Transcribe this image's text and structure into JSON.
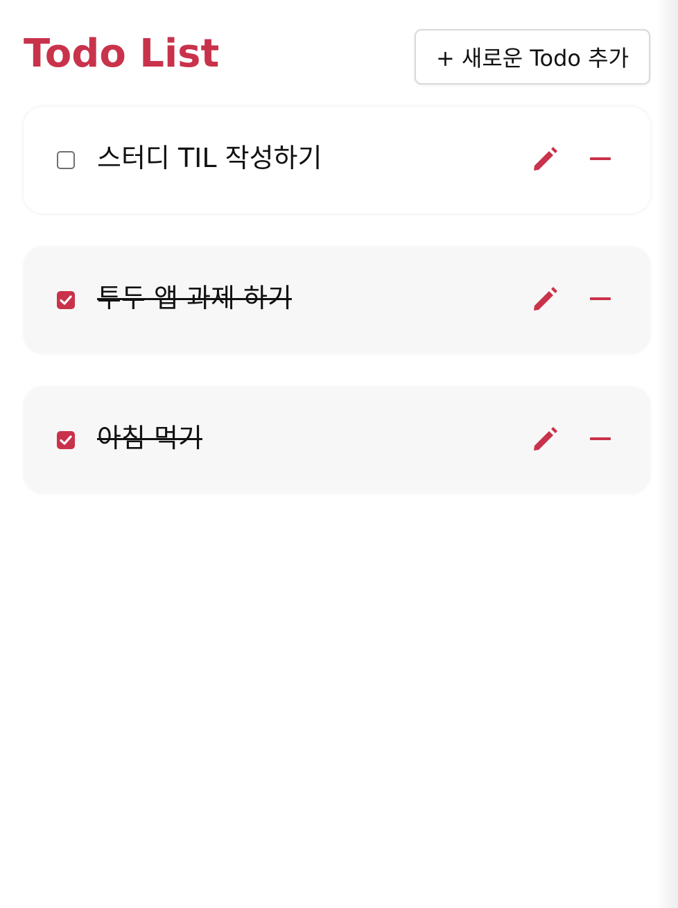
{
  "header": {
    "title": "Todo List",
    "add_button_label": "+ 새로운 Todo 추가"
  },
  "todos": [
    {
      "text": "스터디 TIL 작성하기",
      "completed": false
    },
    {
      "text": "투두 앱 과제 하기",
      "completed": true
    },
    {
      "text": "아침 먹기",
      "completed": true
    }
  ],
  "colors": {
    "accent": "#c9324b",
    "completed_background": "#f7f7f7"
  },
  "icons": {
    "edit": "pencil-icon",
    "delete": "minus-icon",
    "checked": "check-icon"
  }
}
